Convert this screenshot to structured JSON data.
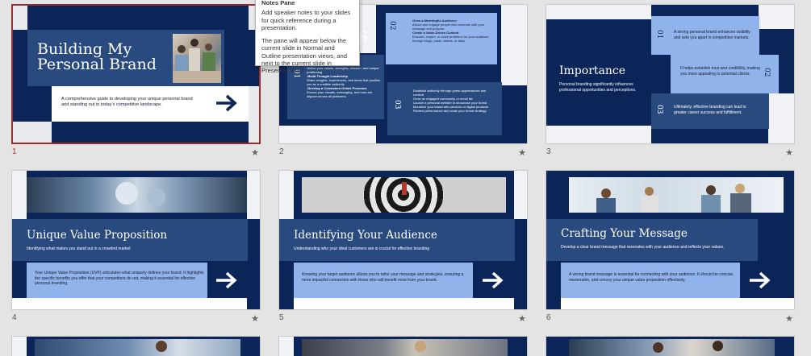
{
  "tooltip": {
    "title": "Notes Pane",
    "line1": "Add speaker notes to your slides for quick reference during a presentation.",
    "line2": "The pane will appear below the current slide in Normal and Outline presentation views, and next to the current slide in Presenter View."
  },
  "slides": [
    {
      "number": "1",
      "star": "★",
      "title": "Building My Personal Brand",
      "body": "A comprehensive guide to developing your unique personal brand and standing out in today's competitive landscape."
    },
    {
      "number": "2",
      "star": "★",
      "title_fragment": "S",
      "blocks": [
        {
          "num": "02",
          "lines": [
            "Grow a Meaningful Audience",
            "Attract and engage people who resonate with your message and purpose",
            "Create a Value-Driven Content",
            "Educate, inspire, or solve problems for your audience through blogs, posts, videos, or talks"
          ]
        },
        {
          "num": "01",
          "lines": [
            "Define your values, strengths, mission, and unique positioning",
            "-Build Thought Leadership",
            "Share insights, experiences, and ideas that position you as a credible authority",
            "-Develop a Consistent Online Presence",
            "Ensure your visuals, messaging, and tone are aligned across all platforms."
          ]
        },
        {
          "num": "03",
          "lines": [
            "Establish authority through guest appearances and content",
            "Grow an engaged community or email list",
            "Launch a personal website to showcase your brand",
            "Monetize your brand with services or digital products",
            "Review performance and scale your brand strategy."
          ]
        }
      ]
    },
    {
      "number": "3",
      "star": "★",
      "title": "Importance",
      "subtitle": "Personal branding significantly influences professional opportunities and perceptions.",
      "items": [
        {
          "num": "01",
          "text": "A strong personal brand enhances visibility and sets you apart in competitive markets."
        },
        {
          "num": "02",
          "text": "It helps establish trust and credibility, making you more appealing to potential clients."
        },
        {
          "num": "03",
          "text": "Ultimately, effective branding can lead to greater career success and fulfillment."
        }
      ]
    },
    {
      "number": "4",
      "star": "★",
      "title": "Unique Value Proposition",
      "subtitle": "Identifying what makes you stand out in a crowded market",
      "body": "Your Unique Value Proposition (UVP) articulates what uniquely defines your brand. It highlights the specific benefits you offer that your competitors do not, making it essential for effective personal branding."
    },
    {
      "number": "5",
      "star": "★",
      "title": "Identifying Your Audience",
      "subtitle": "Understanding who your ideal customers are is crucial for effective branding",
      "body": "Knowing your target audience allows you to tailor your message and strategies, ensuring a more impactful connection with those who will benefit most from your brand."
    },
    {
      "number": "6",
      "star": "★",
      "title": "Crafting Your Message",
      "subtitle": "Develop a clear brand message that resonates with your audience and reflects your values.",
      "body": "A strong brand message is essential for connecting with your audience. It should be concise, memorable, and convey your unique value proposition effectively."
    }
  ]
}
